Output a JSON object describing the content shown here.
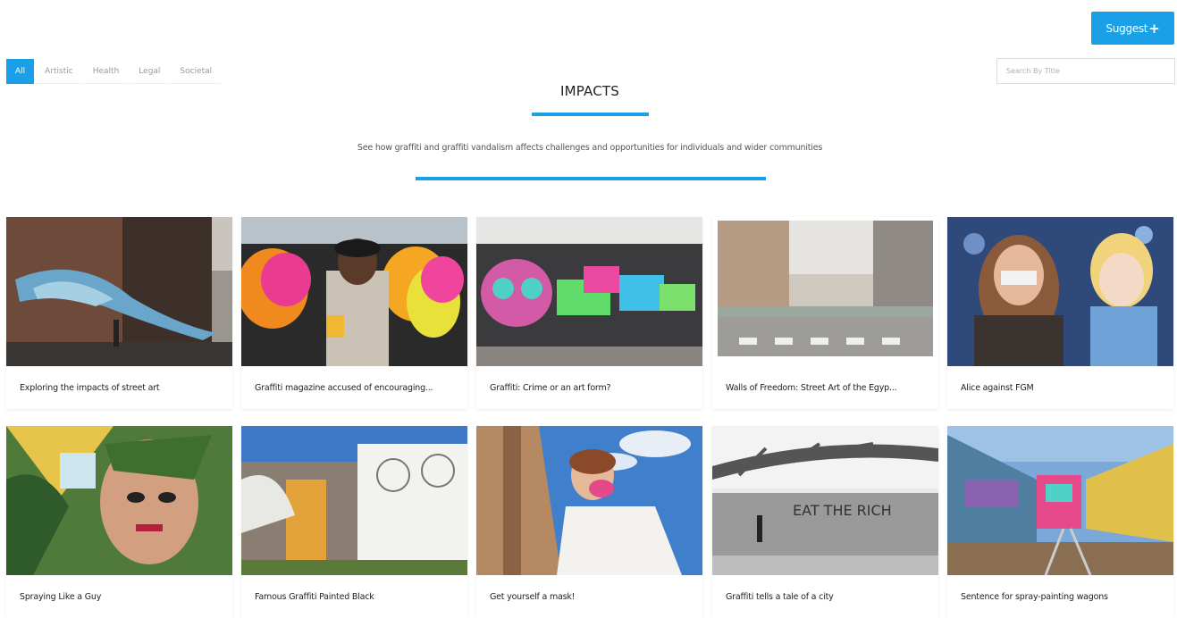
{
  "header": {
    "suggest_label": "Suggest",
    "suggest_icon": "plus-icon"
  },
  "filters": [
    {
      "label": "All",
      "active": true
    },
    {
      "label": "Artistic",
      "active": false
    },
    {
      "label": "Health",
      "active": false
    },
    {
      "label": "Legal",
      "active": false
    },
    {
      "label": "Societal",
      "active": false
    }
  ],
  "search": {
    "placeholder": "Search By Title"
  },
  "page": {
    "title": "IMPACTS",
    "subtitle": "See how graffiti and graffiti vandalism affects challenges and opportunities for individuals and wider communities"
  },
  "cards": [
    {
      "title": "Exploring the impacts of street art"
    },
    {
      "title": "Graffiti magazine accused of encouraging..."
    },
    {
      "title": "Graffiti: Crime or an art form?"
    },
    {
      "title": "Walls of Freedom: Street Art of the Egyp..."
    },
    {
      "title": "Alice against FGM"
    },
    {
      "title": "Spraying Like a Guy"
    },
    {
      "title": "Famous Graffiti Painted Black"
    },
    {
      "title": "Get yourself a mask!"
    },
    {
      "title": "Graffiti tells a tale of a city"
    },
    {
      "title": "Sentence for spray-painting wagons"
    }
  ],
  "image_texts": {
    "wall_text": "EAT THE RICH"
  },
  "colors": {
    "accent": "#1aa0e6"
  }
}
